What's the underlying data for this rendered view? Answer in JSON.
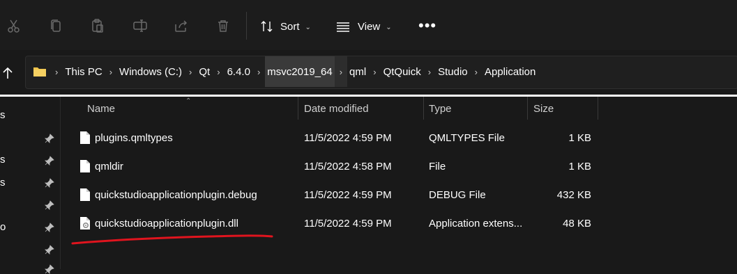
{
  "toolbar": {
    "sort_label": "Sort",
    "view_label": "View",
    "more_label": "•••"
  },
  "address": {
    "crumbs": [
      "This PC",
      "Windows (C:)",
      "Qt",
      "6.4.0",
      "msvc2019_64",
      "qml",
      "QtQuick",
      "Studio",
      "Application"
    ],
    "active_crumb": "msvc2019_64"
  },
  "nav": {
    "fragments": [
      "s",
      "s",
      "s",
      "o"
    ]
  },
  "columns": {
    "name": "Name",
    "date": "Date modified",
    "type": "Type",
    "size": "Size"
  },
  "files": [
    {
      "name": "plugins.qmltypes",
      "date": "11/5/2022 4:59 PM",
      "type": "QMLTYPES File",
      "size": "1 KB",
      "icon": "document-icon"
    },
    {
      "name": "qmldir",
      "date": "11/5/2022 4:58 PM",
      "type": "File",
      "size": "1 KB",
      "icon": "document-icon"
    },
    {
      "name": "quickstudioapplicationplugin.debug",
      "date": "11/5/2022 4:59 PM",
      "type": "DEBUG File",
      "size": "432 KB",
      "icon": "document-icon"
    },
    {
      "name": "quickstudioapplicationplugin.dll",
      "date": "11/5/2022 4:59 PM",
      "type": "Application extens...",
      "size": "48 KB",
      "icon": "dll-gear-icon"
    }
  ],
  "colors": {
    "background": "#191919",
    "toolbar": "#1c1c1c",
    "active_crumb": "#3a3a3a",
    "underline_annotation": "#e0141e",
    "folder": "#f0c44b"
  }
}
